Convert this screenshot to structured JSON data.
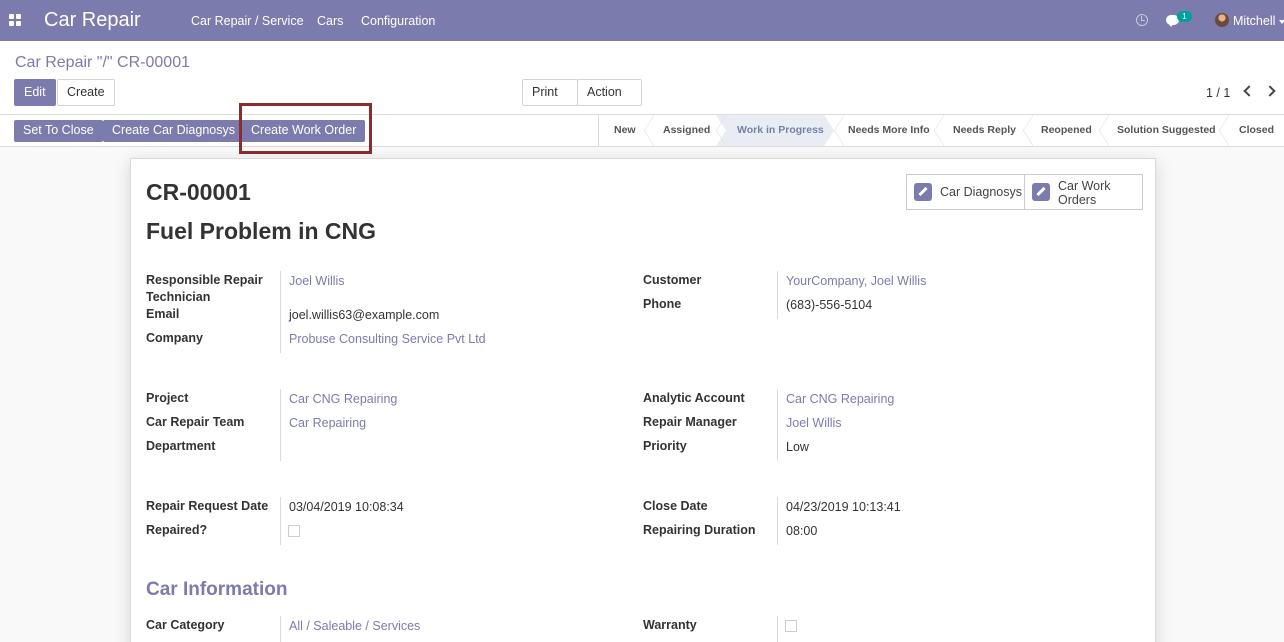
{
  "navbar": {
    "brand": "Car Repair",
    "menu": [
      "Car Repair / Service",
      "Cars",
      "Configuration"
    ],
    "notification_count": "1",
    "user_name": "Mitchell"
  },
  "control_panel": {
    "breadcrumb": "Car Repair \"/\" CR-00001",
    "edit_label": "Edit",
    "create_label": "Create",
    "print_label": "Print",
    "action_label": "Action",
    "pager": "1 / 1"
  },
  "statusbar": {
    "buttons": [
      "Set To Close",
      "Create Car Diagnosys",
      "Create Work Order"
    ],
    "stages": [
      "New",
      "Assigned",
      "Work in Progress",
      "Needs More Info",
      "Needs Reply",
      "Reopened",
      "Solution Suggested",
      "Closed"
    ],
    "active_stage": "Work in Progress"
  },
  "record": {
    "reference": "CR-00001",
    "subject": "Fuel Problem in CNG",
    "smart_buttons": [
      "Car Diagnosys",
      "Car Work Orders"
    ],
    "fields": {
      "technician_label": "Responsible Repair Technician",
      "technician": "Joel Willis",
      "email_label": "Email",
      "email": "joel.willis63@example.com",
      "company_label": "Company",
      "company": "Probuse Consulting Service Pvt Ltd",
      "customer_label": "Customer",
      "customer": "YourCompany, Joel Willis",
      "phone_label": "Phone",
      "phone": "(683)-556-5104",
      "project_label": "Project",
      "project": "Car CNG Repairing",
      "team_label": "Car Repair Team",
      "team": "Car Repairing",
      "department_label": "Department",
      "analytic_label": "Analytic Account",
      "analytic": "Car CNG Repairing",
      "manager_label": "Repair Manager",
      "manager": "Joel Willis",
      "priority_label": "Priority",
      "priority": "Low",
      "request_date_label": "Repair Request Date",
      "request_date": "03/04/2019 10:08:34",
      "repaired_label": "Repaired?",
      "close_date_label": "Close Date",
      "close_date": "04/23/2019 10:13:41",
      "duration_label": "Repairing Duration",
      "duration": "08:00"
    },
    "car_info_title": "Car Information",
    "car_category_label": "Car Category",
    "car_category": "All / Saleable / Services",
    "warranty_label": "Warranty"
  }
}
